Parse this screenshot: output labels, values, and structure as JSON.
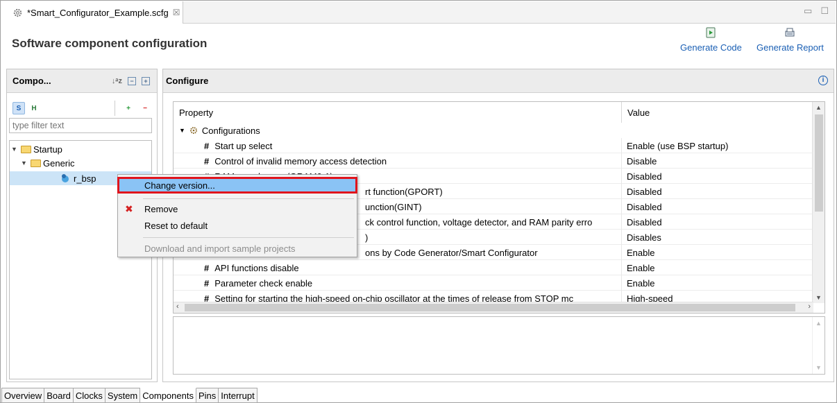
{
  "editor_tab": {
    "title": "*Smart_Configurator_Example.scfg",
    "close": "☒"
  },
  "window_controls": {
    "minimize": "▭",
    "maximize": "☐"
  },
  "header": {
    "title": "Software component configuration",
    "generate_code": "Generate Code",
    "generate_report": "Generate Report"
  },
  "components_panel": {
    "title": "Compo...",
    "filter_placeholder": "type filter text",
    "tree": [
      {
        "label": "Startup"
      },
      {
        "label": "Generic"
      },
      {
        "label": "r_bsp"
      }
    ]
  },
  "configure_panel": {
    "title": "Configure",
    "columns": {
      "property": "Property",
      "value": "Value"
    },
    "group": "Configurations",
    "rows": [
      {
        "property": "Start up select",
        "value": "Enable (use BSP startup)"
      },
      {
        "property": "Control of invalid memory access detection",
        "value": "Disable"
      },
      {
        "property": "RAM guard space(GRAM0-1)",
        "value": "Disabled"
      },
      {
        "property": "rt function(GPORT)",
        "value": "Disabled"
      },
      {
        "property": "unction(GINT)",
        "value": "Disabled"
      },
      {
        "property": "ck control function, voltage detector, and RAM parity erro",
        "value": "Disabled"
      },
      {
        "property": ")",
        "value": "Disables"
      },
      {
        "property": "ons by Code Generator/Smart Configurator",
        "value": "Enable"
      },
      {
        "property": "API functions disable",
        "value": "Enable"
      },
      {
        "property": "Parameter check enable",
        "value": "Enable"
      },
      {
        "property": "Setting for starting the high-speed on-chip oscillator at the times of release from STOP mc",
        "value": "High-speed"
      }
    ]
  },
  "context_menu": {
    "items": [
      {
        "label": "Change version...",
        "highlighted": true
      },
      {
        "label": "Remove"
      },
      {
        "label": "Reset to default"
      },
      {
        "label": "Download and import sample projects",
        "disabled": true
      }
    ]
  },
  "bottom_tabs": [
    "Overview",
    "Board",
    "Clocks",
    "System",
    "Components",
    "Pins",
    "Interrupt"
  ],
  "active_bottom_tab": "Components",
  "colors": {
    "menu_highlight": "#8ac3f5",
    "highlight_border": "#e0141c",
    "link": "#1a5fb4"
  }
}
